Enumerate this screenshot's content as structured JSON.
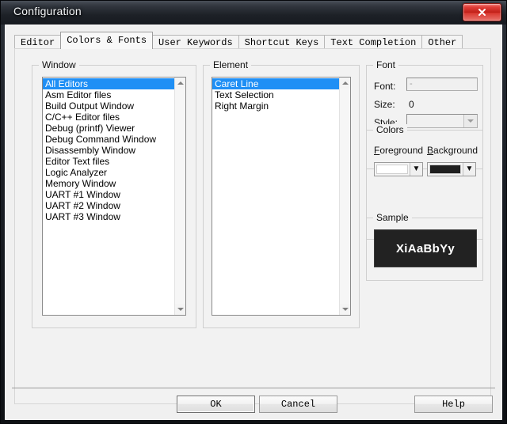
{
  "window": {
    "title": "Configuration",
    "close_label": "x",
    "close_icon": "close-icon"
  },
  "tabs": [
    {
      "label": "Editor",
      "active": false
    },
    {
      "label": "Colors & Fonts",
      "active": true
    },
    {
      "label": "User Keywords",
      "active": false
    },
    {
      "label": "Shortcut Keys",
      "active": false
    },
    {
      "label": "Text Completion",
      "active": false
    },
    {
      "label": "Other",
      "active": false
    }
  ],
  "window_group": {
    "label": "Window",
    "items": [
      "All Editors",
      "Asm Editor files",
      "Build Output Window",
      "C/C++ Editor files",
      "Debug (printf) Viewer",
      "Debug Command Window",
      "Disassembly Window",
      "Editor Text files",
      "Logic Analyzer",
      "Memory Window",
      "UART #1 Window",
      "UART #2 Window",
      "UART #3 Window"
    ],
    "selected_index": 0
  },
  "element_group": {
    "label": "Element",
    "items": [
      "Caret Line",
      "Text Selection",
      "Right Margin"
    ],
    "selected_index": 0
  },
  "font_group": {
    "label": "Font",
    "font_label": "Font:",
    "font_value": "-",
    "size_label": "Size:",
    "size_value": "0",
    "style_label": "Style:",
    "style_value": ""
  },
  "colors_group": {
    "label": "Colors",
    "foreground_label": "Foreground",
    "foreground_accel": "F",
    "foreground_rest": "oreground",
    "foreground_color": "#ffffff",
    "background_label": "Background",
    "background_accel": "B",
    "background_rest": "ackground",
    "background_color": "#1f1f1f",
    "dropdown_glyph": "▼"
  },
  "sample_group": {
    "label": "Sample",
    "text": "XiAaBbYy",
    "text_color": "#ffffff",
    "bg_color": "#222222"
  },
  "buttons": {
    "ok": "OK",
    "cancel": "Cancel",
    "help": "Help"
  },
  "scrollbar": {
    "up_icon": "scroll-up-arrow-icon",
    "down_icon": "scroll-down-arrow-icon"
  },
  "theme": {
    "selection_blue": "#1f8ff5",
    "dialog_bg": "#f0f0f0",
    "close_red": "#bf1f18"
  }
}
